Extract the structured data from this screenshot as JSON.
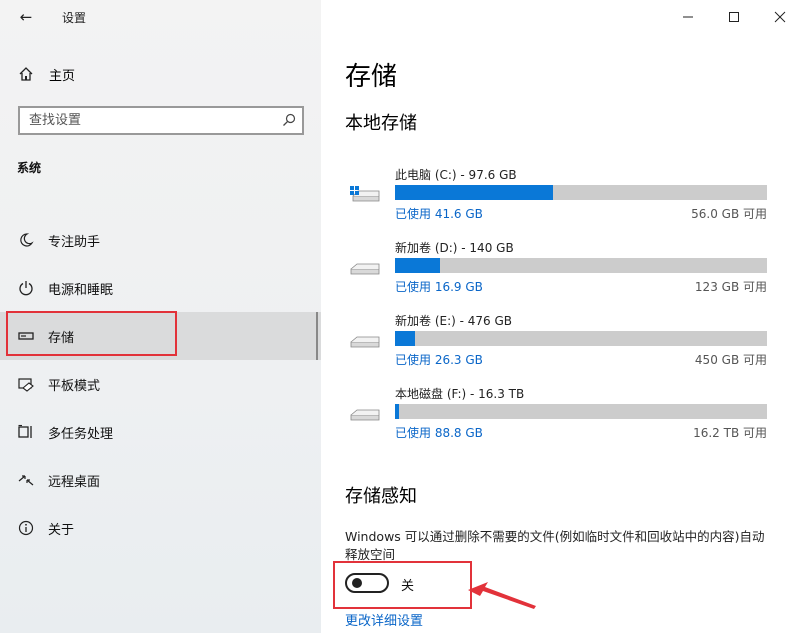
{
  "window": {
    "title": "设置"
  },
  "sidebar": {
    "home_label": "主页",
    "search_placeholder": "查找设置",
    "section_label": "系统",
    "items": [
      {
        "label": "专注助手",
        "icon": "moon-icon"
      },
      {
        "label": "电源和睡眠",
        "icon": "power-icon"
      },
      {
        "label": "存储",
        "icon": "storage-icon",
        "active": true
      },
      {
        "label": "平板模式",
        "icon": "tablet-icon"
      },
      {
        "label": "多任务处理",
        "icon": "multitask-icon"
      },
      {
        "label": "远程桌面",
        "icon": "remote-desktop-icon"
      },
      {
        "label": "关于",
        "icon": "info-icon"
      }
    ]
  },
  "main": {
    "title": "存储",
    "local_title": "本地存储",
    "drives": [
      {
        "name": "此电脑 (C:) - 97.6 GB",
        "used": "已使用 41.6 GB",
        "free": "56.0 GB 可用",
        "used_fraction": 0.426,
        "system": true
      },
      {
        "name": "新加卷 (D:) - 140 GB",
        "used": "已使用 16.9 GB",
        "free": "123 GB 可用",
        "used_fraction": 0.121,
        "system": false
      },
      {
        "name": "新加卷 (E:) - 476 GB",
        "used": "已使用 26.3 GB",
        "free": "450 GB 可用",
        "used_fraction": 0.055,
        "system": false
      },
      {
        "name": "本地磁盘 (F:) - 16.3 TB",
        "used": "已使用 88.8 GB",
        "free": "16.2 TB 可用",
        "used_fraction": 0.005,
        "system": false
      }
    ],
    "sense": {
      "title": "存储感知",
      "description": "Windows 可以通过删除不需要的文件(例如临时文件和回收站中的内容)自动释放空间",
      "toggle_label": "关",
      "toggle_on": false,
      "link": "更改详细设置"
    }
  },
  "colors": {
    "accent": "#0a78d7",
    "link": "#0a66c8",
    "highlight": "#e2323a"
  }
}
